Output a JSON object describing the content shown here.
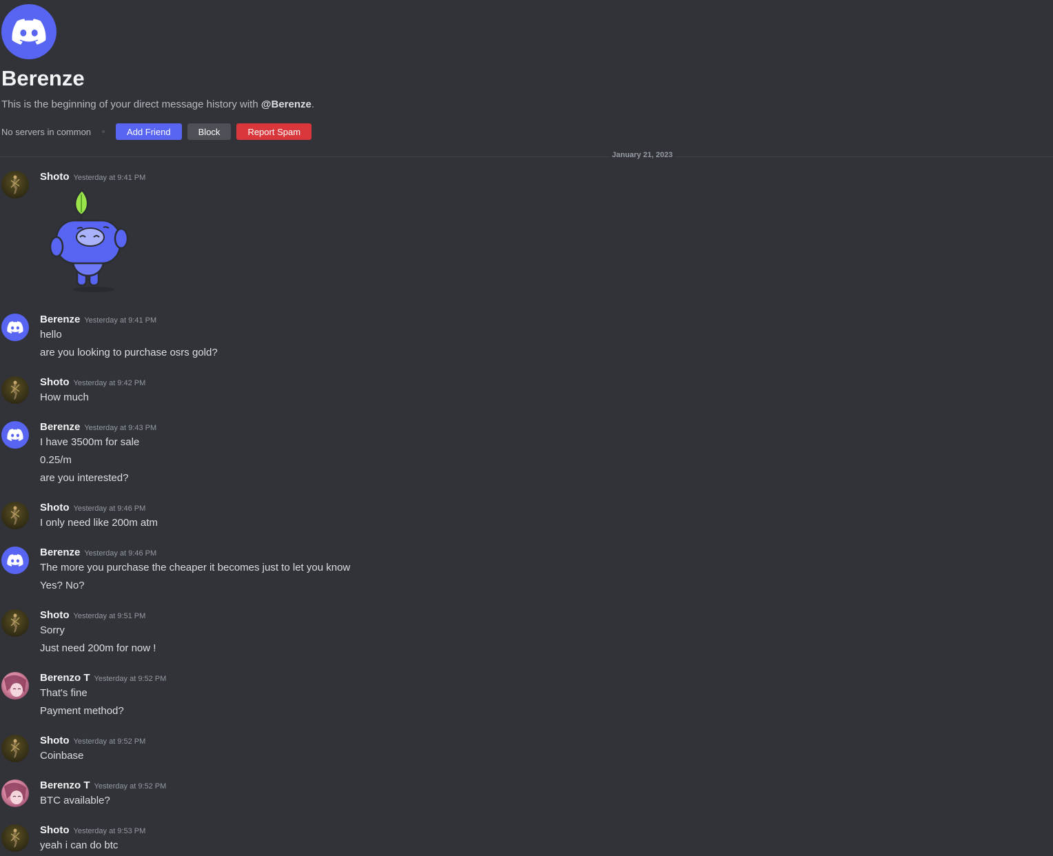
{
  "dm": {
    "title": "Berenze",
    "intro_prefix": "This is the beginning of your direct message history with ",
    "intro_handle": "@Berenze",
    "intro_suffix": ".",
    "no_servers": "No servers in common",
    "add_friend": "Add Friend",
    "block": "Block",
    "report_spam": "Report Spam"
  },
  "divider": {
    "date": "January 21, 2023"
  },
  "messages": [
    {
      "user": "Shoto",
      "time": "Yesterday at 9:41 PM",
      "avatar": "shoto-avatar",
      "sticker": "wumpus-sticker",
      "lines": []
    },
    {
      "user": "Berenze",
      "time": "Yesterday at 9:41 PM",
      "avatar": "discord-avatar",
      "lines": [
        "hello",
        "are you looking to purchase osrs gold?"
      ]
    },
    {
      "user": "Shoto",
      "time": "Yesterday at 9:42 PM",
      "avatar": "shoto-avatar",
      "lines": [
        "How much"
      ]
    },
    {
      "user": "Berenze",
      "time": "Yesterday at 9:43 PM",
      "avatar": "discord-avatar",
      "lines": [
        "I have 3500m for sale",
        "0.25/m",
        "are you interested?"
      ]
    },
    {
      "user": "Shoto",
      "time": "Yesterday at 9:46 PM",
      "avatar": "shoto-avatar",
      "lines": [
        "I only need like 200m atm"
      ]
    },
    {
      "user": "Berenze",
      "time": "Yesterday at 9:46 PM",
      "avatar": "discord-avatar",
      "lines": [
        "The more you purchase the cheaper it becomes just to let you know",
        "Yes? No?"
      ]
    },
    {
      "user": "Shoto",
      "time": "Yesterday at 9:51 PM",
      "avatar": "shoto-avatar",
      "lines": [
        "Sorry",
        "Just need 200m for now !"
      ]
    },
    {
      "user": "Berenzo T",
      "time": "Yesterday at 9:52 PM",
      "avatar": "berenzo-avatar",
      "lines": [
        "That's fine",
        "Payment method?"
      ]
    },
    {
      "user": "Shoto",
      "time": "Yesterday at 9:52 PM",
      "avatar": "shoto-avatar",
      "lines": [
        "Coinbase"
      ]
    },
    {
      "user": "Berenzo T",
      "time": "Yesterday at 9:52 PM",
      "avatar": "berenzo-avatar",
      "lines": [
        "BTC available?"
      ]
    },
    {
      "user": "Shoto",
      "time": "Yesterday at 9:53 PM",
      "avatar": "shoto-avatar",
      "lines": [
        "yeah i can do btc"
      ]
    }
  ],
  "colors": {
    "background": "#313338",
    "blurple": "#5865f2",
    "danger": "#da373c",
    "secondary": "#4e5058",
    "text": "#dbdee1"
  }
}
